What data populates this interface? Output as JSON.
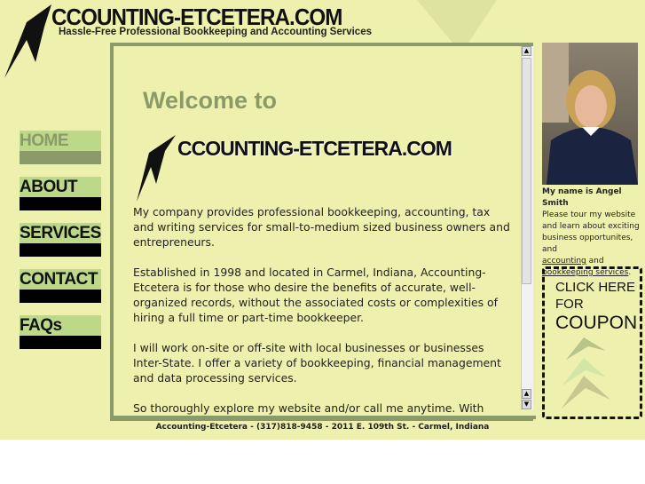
{
  "header": {
    "logo_title": "CCOUNTING-ETCETERA.COM",
    "tagline": "Hassle-Free  Professional Bookkeeping and Accounting Services"
  },
  "nav": [
    {
      "label": "HOME",
      "active": true
    },
    {
      "label": "ABOUT"
    },
    {
      "label": "SERVICES"
    },
    {
      "label": "CONTACT"
    },
    {
      "label": "FAQs"
    }
  ],
  "main": {
    "welcome": "Welcome to",
    "logo_title": "CCOUNTING-ETCETERA.COM",
    "paragraphs": [
      "My company provides professional bookkeeping, accounting, tax and writing services for small-to-medium sized business owners and entrepreneurs.",
      "Established in 1998 and located in Carmel, Indiana, Accounting-Etcetera is for those who desire the benefits of accurate, well-organized records, without the associated costs or complexities of hiring a full time or part-time bookkeeper.",
      "I will work on-site or off-site with local businesses or businesses Inter-State. I offer a variety of bookkeeping, financial management and data processing services.",
      "So thoroughly explore my website and/or call me anytime. With Accounting-Etcetera your time is always hassle free."
    ]
  },
  "sidebar": {
    "name": "My name is Angel Smith",
    "intro": "Please tour my website and learn about exciting business opportunites, and",
    "link1": "accounting",
    "and": "and",
    "link2": "bookkeeping services",
    "period": ".",
    "coupon": {
      "line1": "CLICK HERE",
      "line2": "FOR",
      "line3": "COUPON"
    }
  },
  "footer": "Accounting-Etcetera - (317)818-9458 - 2011 E. 109th St. - Carmel, Indiana",
  "colors": {
    "background": "#eef1ad",
    "accent": "#8a9a68",
    "nav_green": "#bcd98a"
  }
}
